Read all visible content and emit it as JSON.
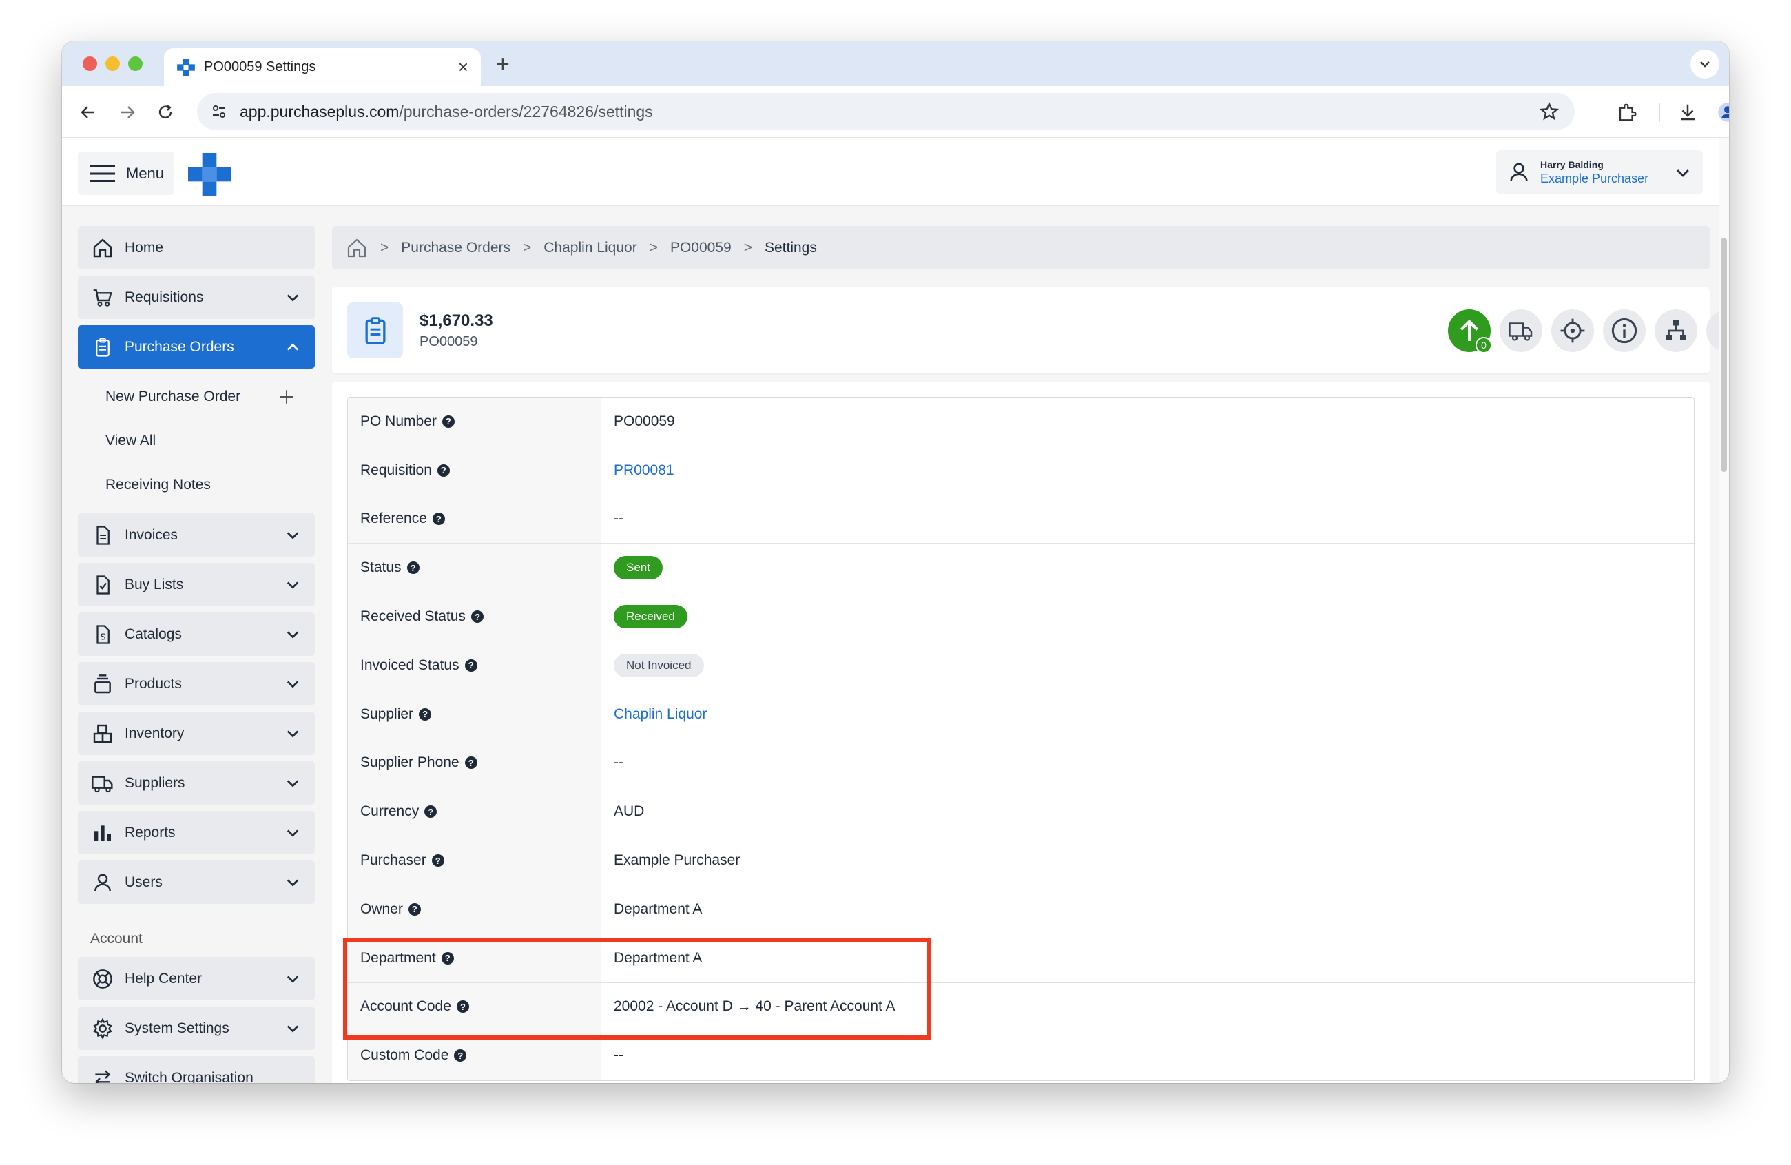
{
  "browser": {
    "tab_title": "PO00059 Settings",
    "url_host": "app.purchaseplus.com",
    "url_path": "/purchase-orders/22764826/settings",
    "new_tab_label": "+",
    "close_label": "×"
  },
  "topbar": {
    "menu_label": "Menu",
    "user_name": "Harry Balding",
    "user_role": "Example Purchaser"
  },
  "sidebar": {
    "items": [
      {
        "label": "Home"
      },
      {
        "label": "Requisitions"
      },
      {
        "label": "Purchase Orders"
      },
      {
        "label": "Invoices"
      },
      {
        "label": "Buy Lists"
      },
      {
        "label": "Catalogs"
      },
      {
        "label": "Products"
      },
      {
        "label": "Inventory"
      },
      {
        "label": "Suppliers"
      },
      {
        "label": "Reports"
      },
      {
        "label": "Users"
      }
    ],
    "sub_items": [
      {
        "label": "New Purchase Order"
      },
      {
        "label": "View All"
      },
      {
        "label": "Receiving Notes"
      }
    ],
    "account_heading": "Account",
    "account_items": [
      {
        "label": "Help Center"
      },
      {
        "label": "System Settings"
      },
      {
        "label": "Switch Organisation"
      }
    ]
  },
  "breadcrumb": [
    "Purchase Orders",
    "Chaplin Liquor",
    "PO00059",
    "Settings"
  ],
  "po_header": {
    "amount": "$1,670.33",
    "po_number": "PO00059",
    "send_badge_count": "0"
  },
  "details": [
    {
      "label": "PO Number",
      "value": "PO00059",
      "type": "text"
    },
    {
      "label": "Requisition",
      "value": "PR00081",
      "type": "link"
    },
    {
      "label": "Reference",
      "value": "--",
      "type": "text"
    },
    {
      "label": "Status",
      "value": "Sent",
      "type": "pill-green"
    },
    {
      "label": "Received Status",
      "value": "Received",
      "type": "pill-green"
    },
    {
      "label": "Invoiced Status",
      "value": "Not Invoiced",
      "type": "pill-gray"
    },
    {
      "label": "Supplier",
      "value": "Chaplin Liquor",
      "type": "link"
    },
    {
      "label": "Supplier Phone",
      "value": "--",
      "type": "text"
    },
    {
      "label": "Currency",
      "value": "AUD",
      "type": "text"
    },
    {
      "label": "Purchaser",
      "value": "Example Purchaser",
      "type": "text"
    },
    {
      "label": "Owner",
      "value": "Department A",
      "type": "text"
    },
    {
      "label": "Department",
      "value": "Department A",
      "type": "text"
    },
    {
      "label": "Account Code",
      "value": "20002 - Account D → 40 - Parent Account A",
      "type": "text"
    },
    {
      "label": "Custom Code",
      "value": "--",
      "type": "text"
    }
  ],
  "help_glyph": "?",
  "colors": {
    "brand_blue": "#1c6fd1",
    "success_green": "#2f9b1f",
    "highlight_red": "#ee3a1f"
  }
}
